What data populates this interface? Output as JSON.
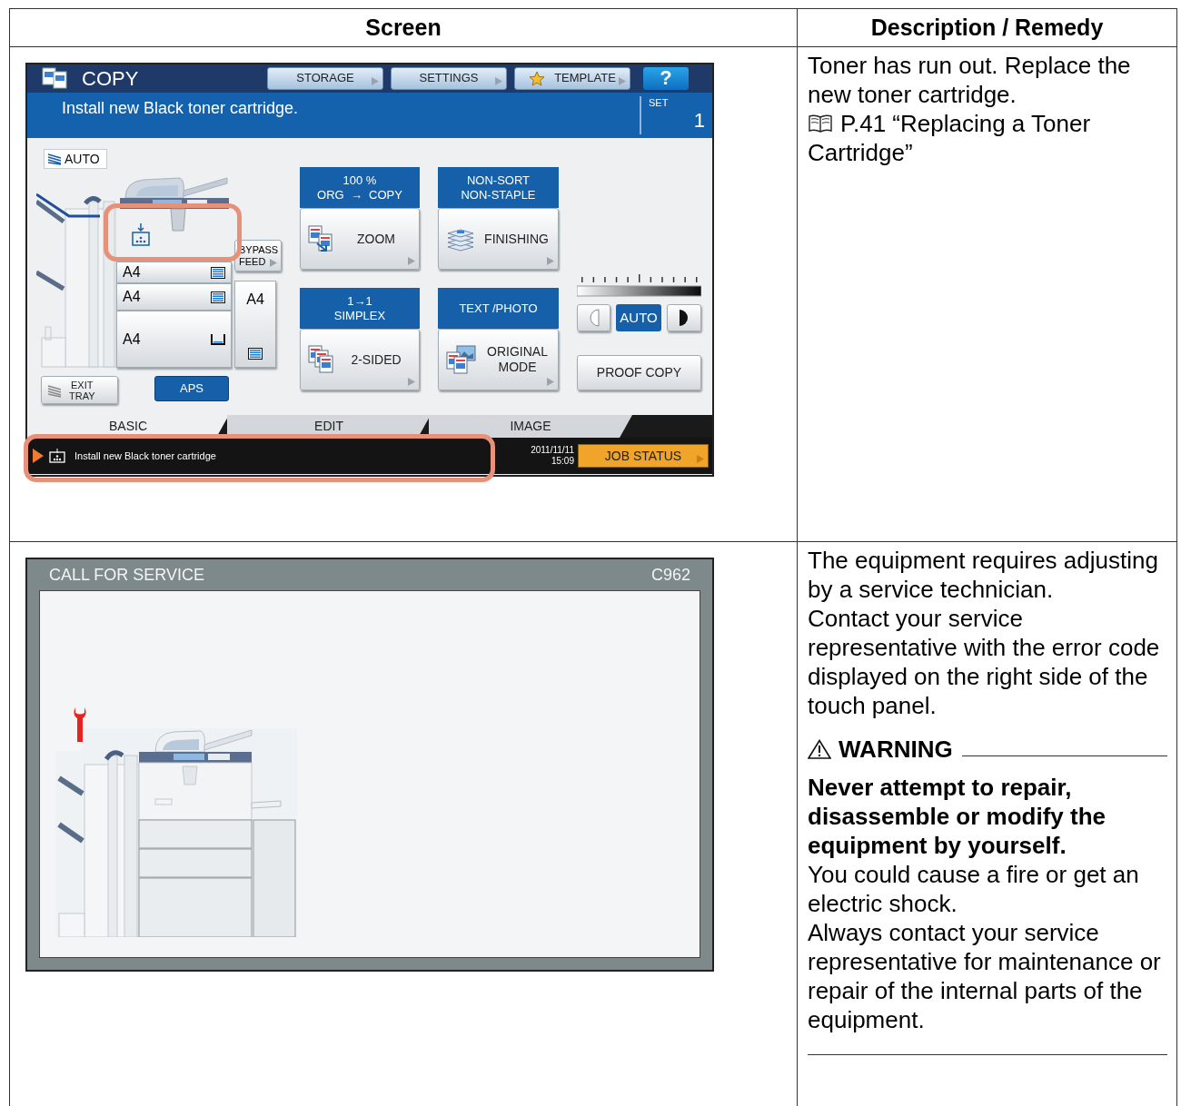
{
  "table": {
    "columns": [
      "Screen",
      "Description / Remedy"
    ]
  },
  "rows": [
    {
      "screen": {
        "kind": "copy_panel",
        "title": "COPY",
        "menu_buttons": [
          {
            "label": "STORAGE",
            "kind": "plain"
          },
          {
            "label": "SETTINGS",
            "kind": "plain"
          },
          {
            "label": "TEMPLATE",
            "kind": "starred"
          }
        ],
        "help_button": "?",
        "message": "Install new Black toner cartridge.",
        "set_label": "SET",
        "set_value": "1",
        "original_size": "AUTO",
        "trays": [
          {
            "label": "A4",
            "empty": false
          },
          {
            "label": "A4",
            "empty": false
          },
          {
            "label": "A4",
            "empty": true
          }
        ],
        "bypass_button": [
          "BYPASS",
          "FEED"
        ],
        "bypass_tray": {
          "label": "A4",
          "empty": false
        },
        "exit_tray": [
          "EXIT",
          "TRAY"
        ],
        "aps": {
          "label": "APS",
          "selected": true
        },
        "functions": [
          {
            "status": [
              "100 %",
              "ORG  →  COPY"
            ],
            "label": [
              "ZOOM"
            ],
            "kind": "zoom"
          },
          {
            "status": [
              "NON-SORT",
              "NON-STAPLE"
            ],
            "label": [
              "FINISHING"
            ],
            "kind": "finishing"
          },
          {
            "status": [
              "1→1",
              "SIMPLEX"
            ],
            "label": [
              "2-SIDED"
            ],
            "kind": "duplex"
          },
          {
            "status": [
              "TEXT /PHOTO"
            ],
            "label": [
              "ORIGINAL",
              "MODE"
            ],
            "kind": "original"
          }
        ],
        "density": {
          "auto_label": "AUTO",
          "auto_selected": true
        },
        "proof_copy": "PROOF COPY",
        "tabs": [
          {
            "label": "BASIC",
            "selected": true
          },
          {
            "label": "EDIT",
            "selected": false
          },
          {
            "label": "IMAGE",
            "selected": false
          }
        ],
        "status_message": "Install new Black toner cartridge",
        "date": "2011/11/11",
        "time": "15:09",
        "job_status": "JOB STATUS"
      },
      "description": {
        "paragraphs": [
          "Toner has run out. Replace the new toner cartridge."
        ],
        "reference": "P.41 “Replacing a Toner Cartridge”"
      }
    },
    {
      "screen": {
        "kind": "service_panel",
        "title": "CALL FOR SERVICE",
        "code": "C962"
      },
      "description": {
        "paragraphs": [
          "The equipment requires adjusting by a service technician.",
          "Contact your service representative with the error code displayed on the right side of the touch panel."
        ],
        "warning": {
          "heading": "WARNING",
          "emphasis": "Never attempt to repair, disassemble or modify the equipment by yourself.",
          "paragraphs": [
            "You could cause a fire or get an electric shock.",
            "Always contact your service representative for maintenance or repair of the internal parts of the equipment."
          ]
        }
      }
    }
  ]
}
